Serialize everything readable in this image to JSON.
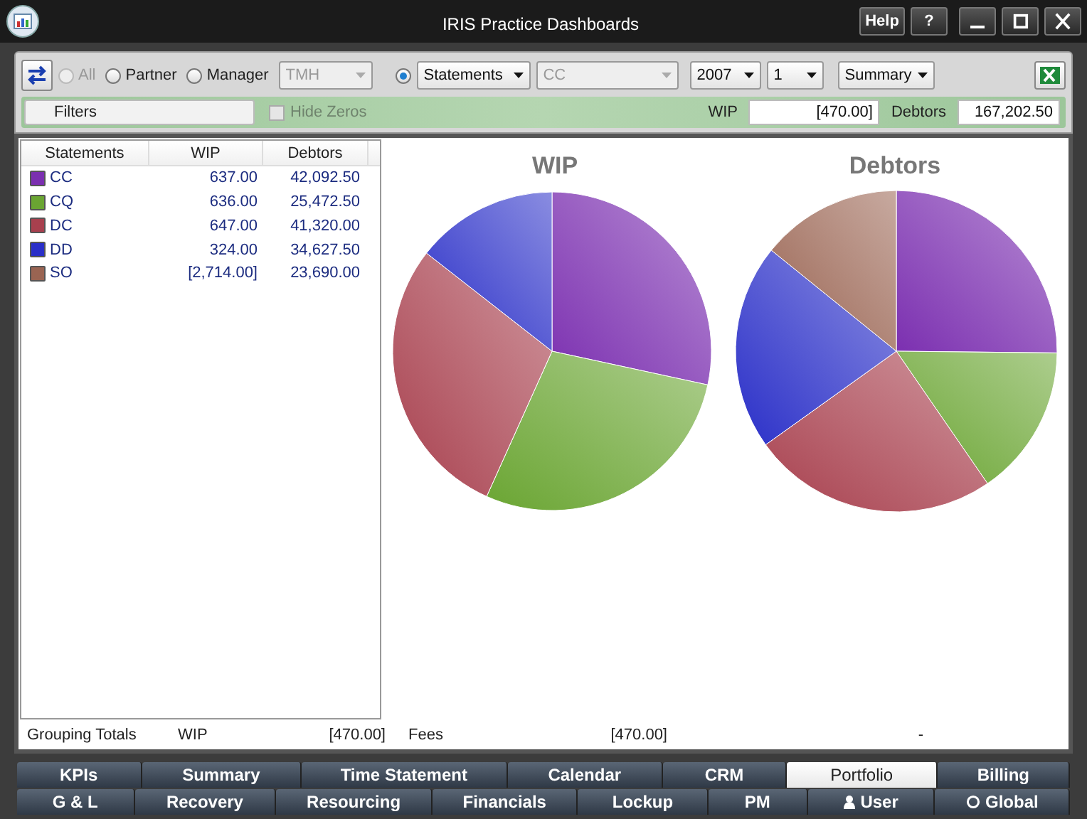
{
  "window": {
    "title": "IRIS Practice Dashboards",
    "buttons": [
      "Help",
      "?"
    ]
  },
  "toolbar": {
    "radios": [
      {
        "label": "All",
        "selected": false,
        "disabled": true
      },
      {
        "label": "Partner",
        "selected": false,
        "disabled": false
      },
      {
        "label": "Manager",
        "selected": false,
        "disabled": false
      }
    ],
    "manager_select": {
      "value": "TMH",
      "disabled": true
    },
    "statements_radio": {
      "selected": true
    },
    "dropdowns": [
      {
        "value": "Statements",
        "disabled": false
      },
      {
        "value": "CC",
        "disabled": true
      },
      {
        "value": "2007",
        "disabled": false
      },
      {
        "value": "1",
        "disabled": false
      },
      {
        "value": "Summary",
        "disabled": false
      }
    ],
    "filters_button": "Filters",
    "hide_zeros": {
      "label": "Hide Zeros",
      "checked": false,
      "disabled": true
    },
    "wip": {
      "label": "WIP",
      "value": "[470.00]"
    },
    "debtors": {
      "label": "Debtors",
      "value": "167,202.50"
    }
  },
  "table": {
    "columns": [
      "Statements",
      "WIP",
      "Debtors"
    ],
    "rows": [
      {
        "name": "CC",
        "color": "#7b2fb0",
        "wip": "637.00",
        "debtors": "42,092.50"
      },
      {
        "name": "CQ",
        "color": "#6aa532",
        "wip": "636.00",
        "debtors": "25,472.50"
      },
      {
        "name": "DC",
        "color": "#a8404e",
        "wip": "647.00",
        "debtors": "41,320.00"
      },
      {
        "name": "DD",
        "color": "#2a2fc8",
        "wip": "324.00",
        "debtors": "34,627.50"
      },
      {
        "name": "SO",
        "color": "#9a6452",
        "wip": "[2,714.00]",
        "debtors": "23,690.00"
      }
    ]
  },
  "charts": [
    {
      "chart_data": {
        "type": "pie",
        "title": "WIP",
        "values": [
          28.39,
          28.34,
          28.83,
          14.44
        ]
      }
    },
    {
      "chart_data": {
        "type": "pie",
        "title": "Debtors",
        "values": [
          25.17,
          15.23,
          24.71,
          20.71,
          14.18
        ]
      }
    }
  ],
  "totals": {
    "label": "Grouping Totals",
    "wip_label": "WIP",
    "wip": "[470.00]",
    "fees_label": "Fees",
    "fees": "[470.00]",
    "column_5": "-"
  },
  "tabs": [
    [
      {
        "label": "KPIs",
        "selected": false
      },
      {
        "label": "Summary",
        "selected": false
      },
      {
        "label": "Time Statement",
        "selected": false
      },
      {
        "label": "Calendar",
        "selected": false
      },
      {
        "label": "CRM",
        "selected": false
      },
      {
        "label": "Portfolio",
        "selected": true
      },
      {
        "label": "Billing",
        "selected": false
      }
    ],
    [
      {
        "label": "G & L",
        "kind": "plain",
        "selected": false
      },
      {
        "label": "Recovery",
        "kind": "plain",
        "selected": false
      },
      {
        "label": "Resourcing",
        "kind": "plain",
        "selected": false
      },
      {
        "label": "Financials",
        "kind": "plain",
        "selected": false
      },
      {
        "label": "Lockup",
        "kind": "plain",
        "selected": false
      },
      {
        "label": "PM",
        "kind": "plain",
        "selected": false
      },
      {
        "label": "User",
        "kind": "person",
        "selected": false
      },
      {
        "label": "Global",
        "kind": "ring",
        "selected": false
      }
    ]
  ]
}
